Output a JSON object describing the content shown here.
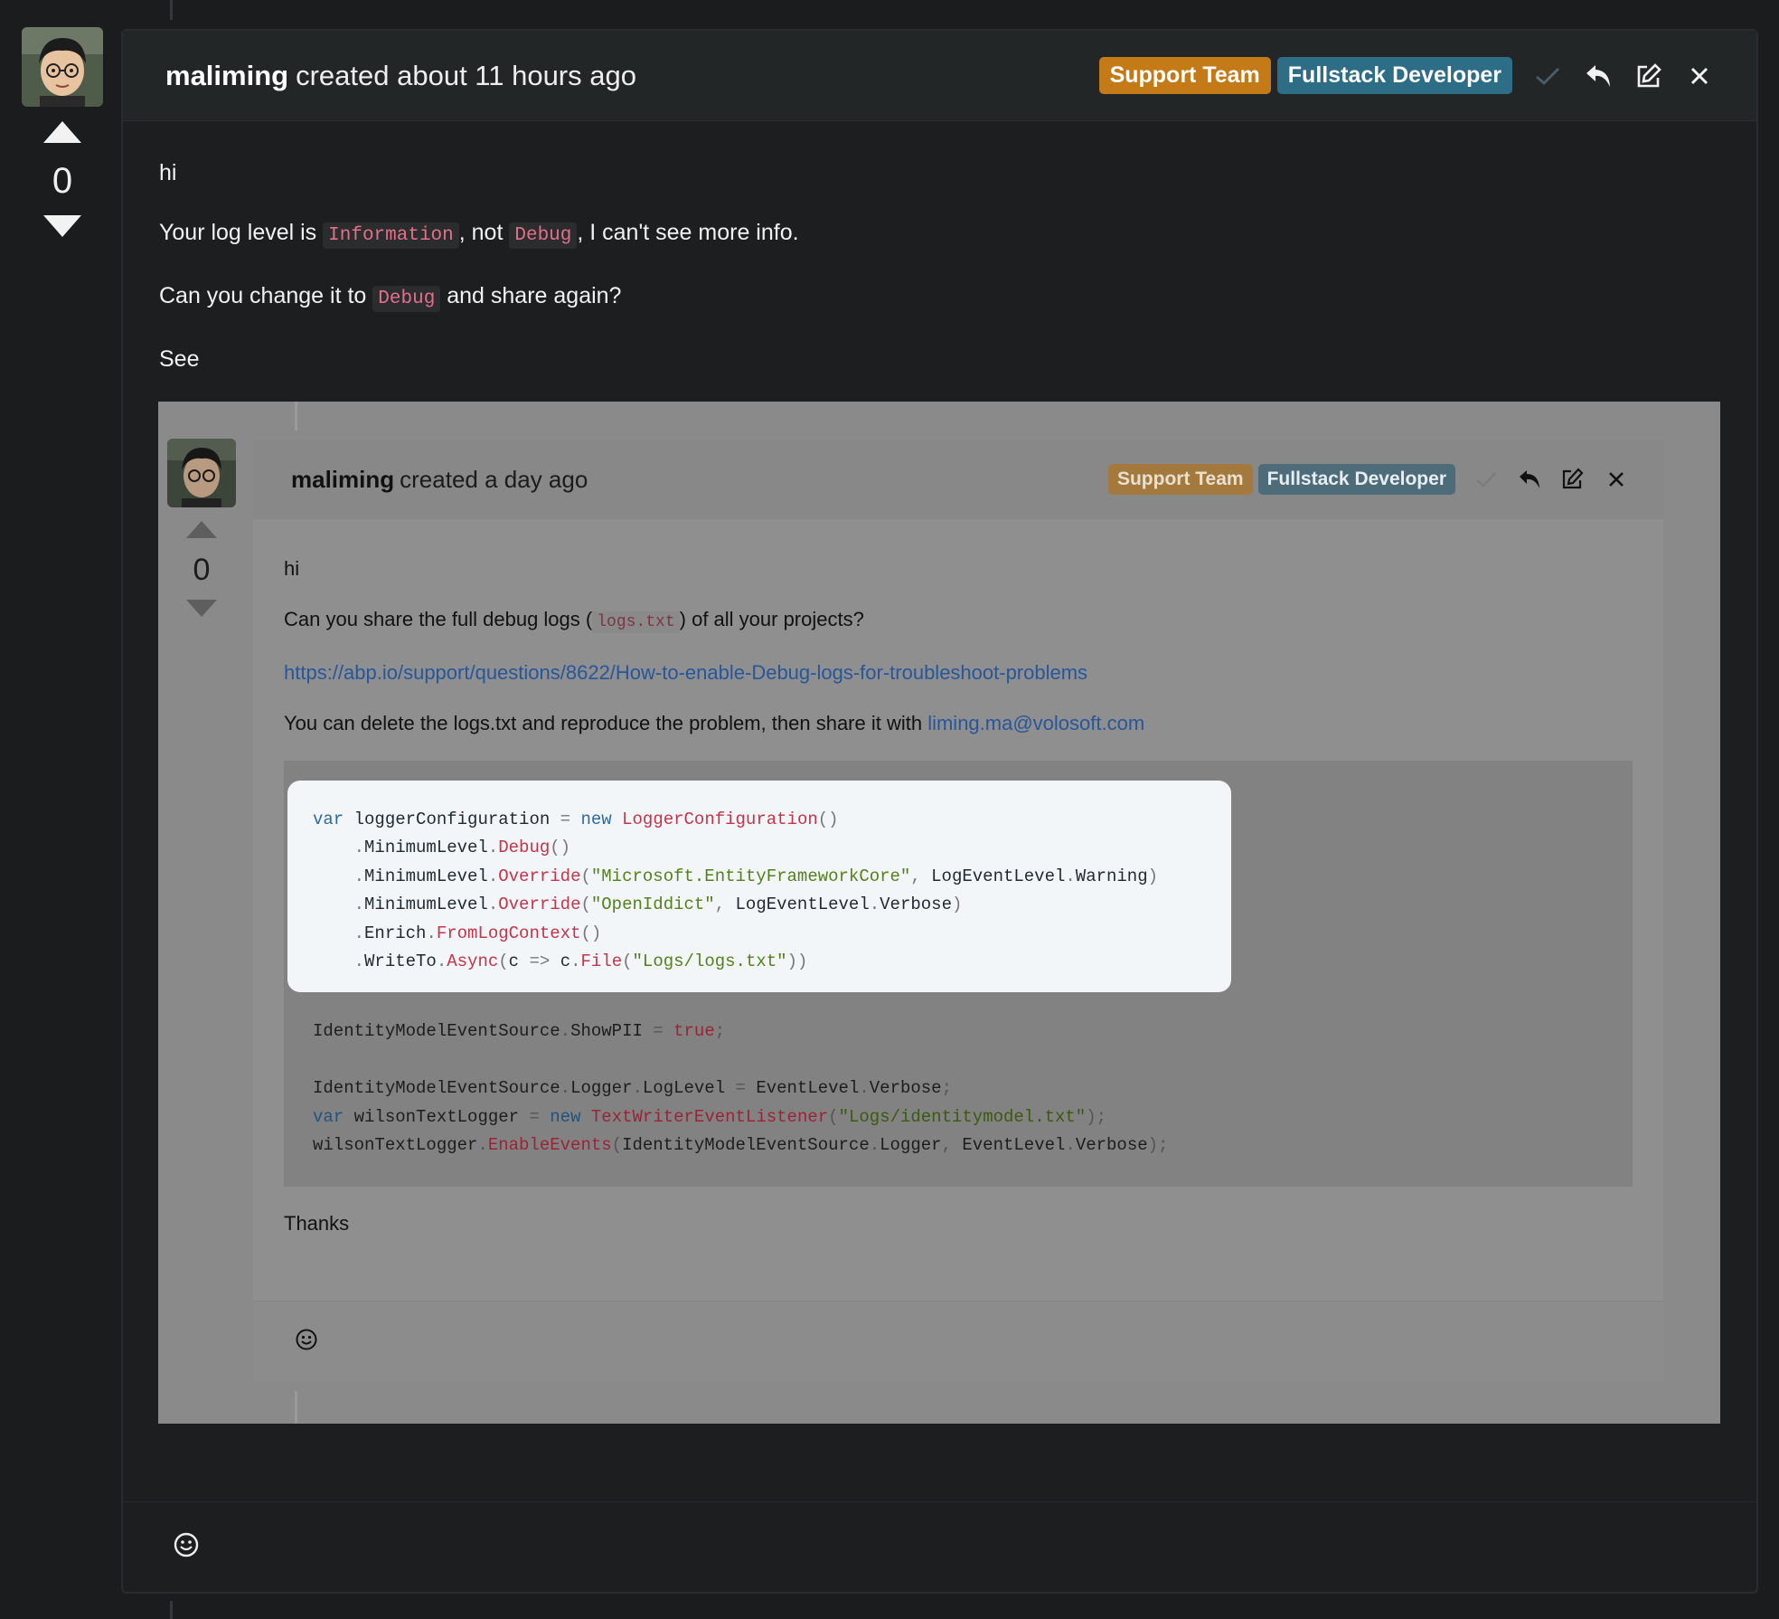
{
  "post": {
    "author": "maliming",
    "created": "created about 11 hours ago",
    "badges": [
      "Support Team",
      "Fullstack Developer"
    ],
    "votes": "0",
    "body": {
      "line1": "hi",
      "line2_a": "Your log level is ",
      "line2_code1": "Information",
      "line2_b": ", not ",
      "line2_code2": "Debug",
      "line2_c": ", I can't see more info.",
      "line3_a": "Can you change it to ",
      "line3_code": "Debug",
      "line3_b": " and share again?",
      "line4": "See"
    }
  },
  "quoted": {
    "author": "maliming",
    "created": "created a day ago",
    "badges": [
      "Support Team",
      "Fullstack Developer"
    ],
    "votes": "0",
    "body": {
      "line1": "hi",
      "line2_a": "Can you share the full debug logs (",
      "line2_code": "logs.txt",
      "line2_b": ") of all your projects?",
      "link": "https://abp.io/support/questions/8622/How-to-enable-Debug-logs-for-troubleshoot-problems",
      "line4_a": "You can delete the logs.txt and reproduce the problem, then share it with ",
      "email": "liming.ma@volosoft.com",
      "thanks": "Thanks"
    }
  },
  "icons": {
    "accept": "check-icon",
    "reply": "reply-icon",
    "edit": "edit-icon",
    "delete": "close-icon",
    "reaction": "smiley-icon",
    "upvote": "triangle-up-icon",
    "downvote": "triangle-down-icon"
  },
  "colors": {
    "badge_support": "#c47a17",
    "badge_fullstack": "#2d6d86",
    "inline_code": "#e2708b",
    "link": "#27569a"
  }
}
